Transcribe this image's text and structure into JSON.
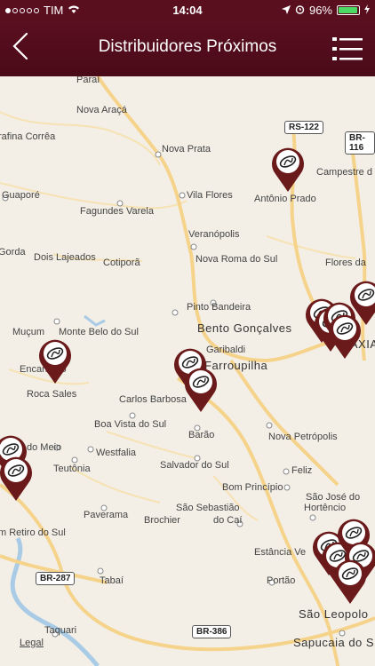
{
  "status_bar": {
    "carrier": "TIM",
    "time": "14:04",
    "battery": "96%",
    "battery_level": 0.96
  },
  "nav": {
    "title": "Distribuidores Próximos"
  },
  "map": {
    "labels": {
      "parai": "Paraí",
      "nova_araca": "Nova Araçá",
      "rafina_correa": "rafina Corrêa",
      "nova_prata": "Nova Prata",
      "guapore": "Guaporé",
      "fagundes_varela": "Fagundes Varela",
      "vila_flores": "Vila Flores",
      "antonio_prado": "Antônio Prado",
      "campestre": "Campestre d",
      "veranopolis": "Veranópolis",
      "gorda": "Gorda",
      "dois_lajeados": "Dois Lajeados",
      "cotipora": "Cotiporã",
      "nova_roma": "Nova Roma do Sul",
      "flores_da": "Flores da",
      "pinto_bandeira": "Pinto Bandeira",
      "mucum": "Muçum",
      "monte_belo": "Monte Belo do Sul",
      "bento": "Bento Gonçalves",
      "encantado": "Encantado",
      "garibaldi": "Garibaldi",
      "caxias": "CAXIAS",
      "roca_sales": "Roca Sales",
      "carlos_barbosa": "Carlos Barbosa",
      "farroupilha": "Farroupilha",
      "boa_vista": "Boa Vista do Sul",
      "barao": "Barão",
      "do_meio": "do Meio",
      "westfalia": "Westfalia",
      "nova_petropolis": "Nova Petrópolis",
      "teutonia": "Teutônia",
      "salvador": "Salvador do Sul",
      "feliz": "Feliz",
      "ado": "ado",
      "bom_principio": "Bom Princípio",
      "sao_jose": "São José do",
      "hortencio": "Hortêncio",
      "paverama": "Paverama",
      "sao_sebastiao": "São Sebastião",
      "do_cai": "do Caí",
      "brochier": "Brochier",
      "retiro": "m Retiro do Sul",
      "estancia": "Estância Ve",
      "portao": "Portão",
      "tabai": "Tabaí",
      "sao_leopoldo": "São Leopolo",
      "taquari": "Taquari",
      "sapucaia": "Sapucaia do S",
      "legal": "Legal"
    },
    "shields": {
      "rs122": "RS-122",
      "br116": "BR-116",
      "br287": "BR-287",
      "br386": "BR-386"
    }
  },
  "colors": {
    "header": "#5a0f1f",
    "pin": "#6a1a1a",
    "road": "#f6d38a",
    "water": "#a9cbe6"
  }
}
